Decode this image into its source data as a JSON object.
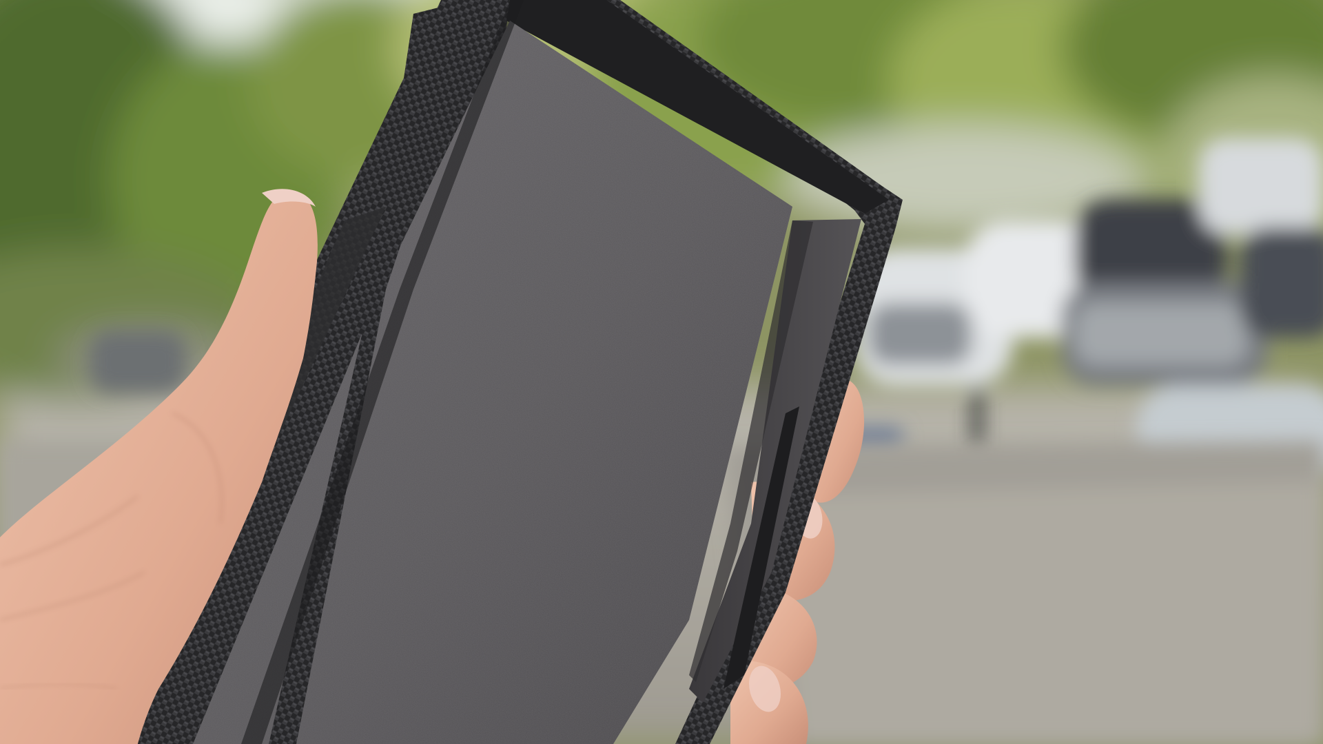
{
  "colors": {
    "sky": "#e9eee8",
    "foliage_dark": "#4f6a2e",
    "foliage_mid": "#7e9444",
    "foliage_light": "#b3be73",
    "ground": "#b5b2a9",
    "road": "#a29f97",
    "car_white": "#dfe2e4",
    "car_dark": "#3c4046",
    "case_suede": "#5c5a5d",
    "case_suede_shadow": "#3f3d40",
    "case_carbon": "#2a2a2c",
    "skin": "#e6b7a0",
    "skin_shadow": "#b98670",
    "nail": "#efd0c6"
  }
}
